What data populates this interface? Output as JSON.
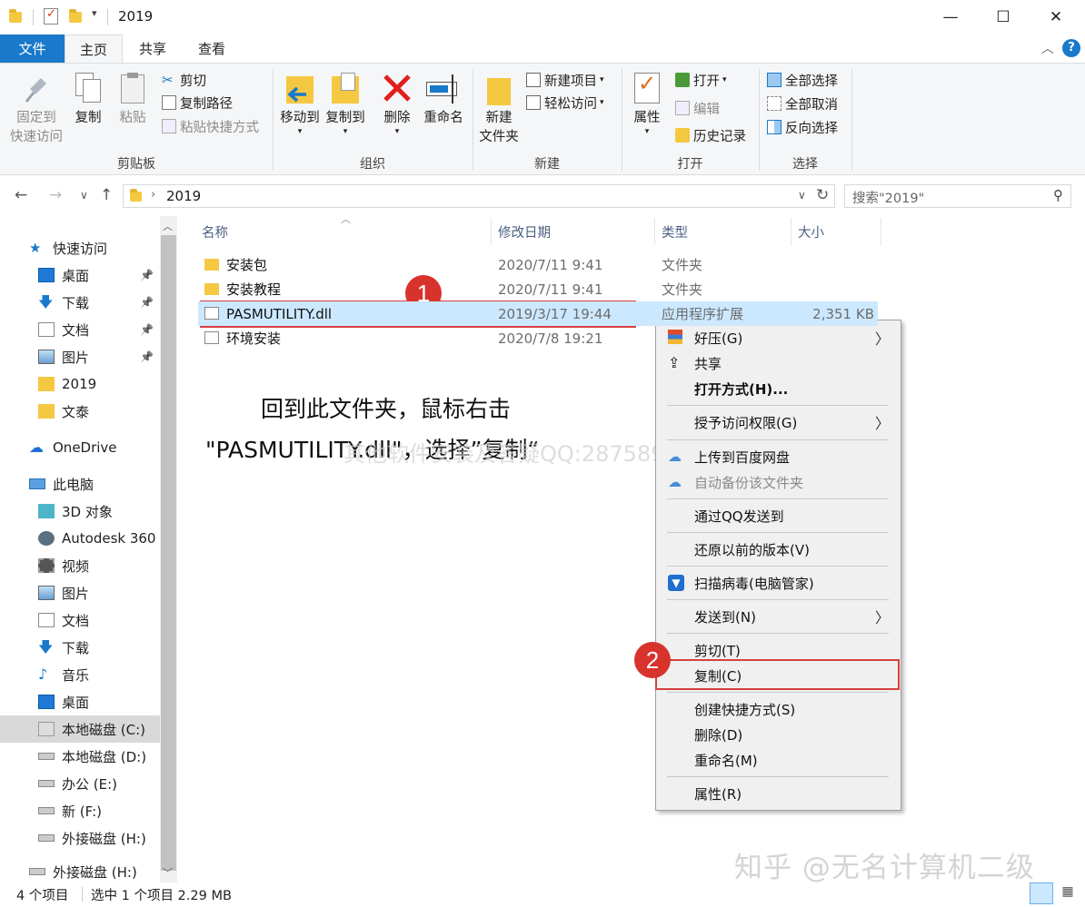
{
  "titlebar": {
    "title": "2019",
    "minimize": "—",
    "maximize": "☐",
    "close": "✕"
  },
  "ribbon_tabs": [
    {
      "label": "文件"
    },
    {
      "label": "主页"
    },
    {
      "label": "共享"
    },
    {
      "label": "查看"
    }
  ],
  "ribbon": {
    "clipboard": {
      "pin_l1": "固定到",
      "pin_l2": "快速访问",
      "copy": "复制",
      "paste": "粘贴",
      "cut": "剪切",
      "copy_path": "复制路径",
      "paste_shortcut": "粘贴快捷方式",
      "group": "剪贴板"
    },
    "organize": {
      "move_to": "移动到",
      "copy_to": "复制到",
      "delete": "删除",
      "rename": "重命名",
      "group": "组织"
    },
    "new": {
      "new_folder_l1": "新建",
      "new_folder_l2": "文件夹",
      "new_item": "新建项目",
      "easy_access": "轻松访问",
      "group": "新建"
    },
    "open": {
      "properties": "属性",
      "open": "打开",
      "edit": "编辑",
      "history": "历史记录",
      "group": "打开"
    },
    "select": {
      "select_all": "全部选择",
      "select_none": "全部取消",
      "invert": "反向选择",
      "group": "选择"
    }
  },
  "address": {
    "path": "2019",
    "search_placeholder": "搜索\"2019\""
  },
  "nav": {
    "quick_access": "快速访问",
    "pinned": [
      {
        "label": "桌面",
        "icon": "desktop-icon"
      },
      {
        "label": "下载",
        "icon": "download-icon"
      },
      {
        "label": "文档",
        "icon": "document-icon"
      },
      {
        "label": "图片",
        "icon": "picture-icon"
      }
    ],
    "recent": [
      {
        "label": "2019",
        "icon": "folder-icon"
      },
      {
        "label": "文泰",
        "icon": "folder-icon"
      }
    ],
    "onedrive": "OneDrive",
    "this_pc": "此电脑",
    "pc_items": [
      {
        "label": "3D 对象",
        "icon": "3d-objects-icon"
      },
      {
        "label": "Autodesk 360",
        "icon": "autodesk-icon"
      },
      {
        "label": "视频",
        "icon": "video-icon"
      },
      {
        "label": "图片",
        "icon": "picture-icon"
      },
      {
        "label": "文档",
        "icon": "document-icon"
      },
      {
        "label": "下载",
        "icon": "download-icon"
      },
      {
        "label": "音乐",
        "icon": "music-icon"
      },
      {
        "label": "桌面",
        "icon": "desktop-icon"
      },
      {
        "label": "本地磁盘 (C:)",
        "icon": "windows-drive-icon"
      },
      {
        "label": "本地磁盘 (D:)",
        "icon": "drive-icon"
      },
      {
        "label": "办公 (E:)",
        "icon": "drive-icon"
      },
      {
        "label": "新 (F:)",
        "icon": "drive-icon"
      },
      {
        "label": "外接磁盘 (H:)",
        "icon": "drive-icon"
      }
    ],
    "external": "外接磁盘 (H:)"
  },
  "columns": {
    "name": "名称",
    "date": "修改日期",
    "type": "类型",
    "size": "大小"
  },
  "files": [
    {
      "name": "安装包",
      "date": "2020/7/11 9:41",
      "type": "文件夹",
      "size": "",
      "icon": "folder-icon"
    },
    {
      "name": "安装教程",
      "date": "2020/7/11 9:41",
      "type": "文件夹",
      "size": "",
      "icon": "folder-icon"
    },
    {
      "name": "PASMUTILITY.dll",
      "date": "2019/3/17 19:44",
      "type": "应用程序扩展",
      "size": "2,351 KB",
      "icon": "dll-file-icon"
    },
    {
      "name": "环境安装",
      "date": "2020/7/8 19:21",
      "type": "",
      "size": "",
      "icon": "file-icon"
    }
  ],
  "context_menu": [
    {
      "label": "好压(G)",
      "icon": "haozip-icon",
      "submenu": true
    },
    {
      "label": "共享",
      "icon": "share-icon"
    },
    {
      "label": "打开方式(H)...",
      "bold": true
    },
    {
      "label": "授予访问权限(G)",
      "submenu": true
    },
    {
      "label": "上传到百度网盘",
      "icon": "baidu-cloud-icon"
    },
    {
      "label": "自动备份该文件夹",
      "icon": "baidu-cloud-icon",
      "disabled": true
    },
    {
      "label": "通过QQ发送到"
    },
    {
      "label": "还原以前的版本(V)"
    },
    {
      "label": "扫描病毒(电脑管家)",
      "icon": "shield-icon"
    },
    {
      "label": "发送到(N)",
      "submenu": true
    },
    {
      "label": "剪切(T)"
    },
    {
      "label": "复制(C)"
    },
    {
      "label": "创建快捷方式(S)"
    },
    {
      "label": "删除(D)"
    },
    {
      "label": "重命名(M)"
    },
    {
      "label": "属性(R)"
    }
  ],
  "annotation": {
    "line1": "回到此文件夹，鼠标右击",
    "line2": "\"PASMUTILITY.dll\"，选择”复制“",
    "badge1": "1",
    "badge2": "2",
    "watermark": "其他软件安装及答疑QQ:2875897828"
  },
  "status": {
    "count": "4 个项目",
    "selected": "选中 1 个项目  2.29 MB"
  },
  "zhihu_watermark": "知乎 @无名计算机二级",
  "colors": {
    "accent": "#1979ca",
    "selection": "#cce8ff",
    "annotation_red": "#d8322c"
  }
}
